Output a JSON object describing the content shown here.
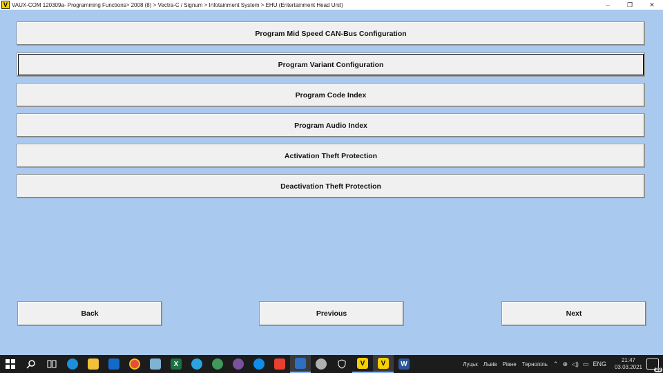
{
  "window": {
    "app_icon_letter": "V",
    "title": "VAUX-COM 120309a- Programming Functions> 2008 (8) > Vectra-C / Signum > Infotainment System > EHU (Entertainment Head Unit)",
    "minimize": "–",
    "restore": "❐",
    "close": "✕"
  },
  "menu": {
    "items": [
      {
        "label": "Program Mid Speed CAN-Bus Configuration"
      },
      {
        "label": "Program Variant Configuration"
      },
      {
        "label": "Program Code Index"
      },
      {
        "label": "Program Audio Index"
      },
      {
        "label": "Activation Theft Protection"
      },
      {
        "label": "Deactivation Theft Protection"
      }
    ],
    "selected_index": 1
  },
  "nav": {
    "back": "Back",
    "previous": "Previous",
    "next": "Next"
  },
  "taskbar": {
    "icons": [
      "windows-start-icon",
      "search-icon",
      "task-view-icon",
      "edge-icon",
      "file-explorer-icon",
      "outlook-icon",
      "chrome-icon",
      "notepad-icon",
      "excel-icon",
      "telegram-icon",
      "network-icon",
      "viber-icon",
      "teamviewer-icon",
      "anydesk-icon",
      "app-icon",
      "app2-icon",
      "security-icon",
      "vauxcom-icon",
      "vauxcom-active-icon",
      "word-icon"
    ],
    "icon_glyph_v": "V",
    "icon_glyph_x": "X",
    "icon_glyph_w": "W",
    "cities": [
      "Луцьк",
      "Львів",
      "Рівне",
      "Тернопіль"
    ],
    "lang": "ENG",
    "time": "21:47",
    "date": "03.03.2021",
    "notifications": "23",
    "colors": {
      "edge": "#1e8fd9",
      "explorer": "#f2c03a",
      "outlook": "#1569c7",
      "chrome": "#e74c3c",
      "excel": "#1d7044",
      "telegram": "#2aa3e0",
      "viber": "#7b519d",
      "teamviewer": "#0e8ee9",
      "anydesk": "#e8402f",
      "vauxcom": "#f4d000",
      "word": "#2b579a"
    }
  }
}
